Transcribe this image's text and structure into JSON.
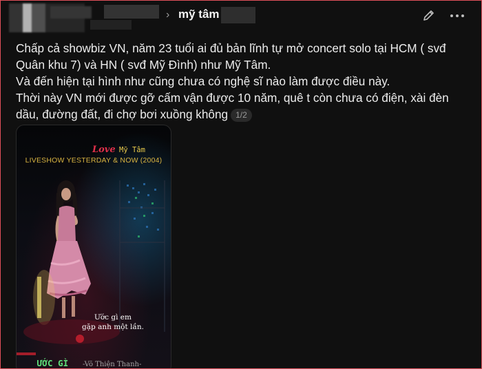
{
  "header": {
    "username": "mỹ tâm",
    "chevron": "›",
    "edit_icon": "pencil-icon",
    "more_icon": "more-horizontal-icon"
  },
  "post": {
    "lines": [
      "Chấp cả showbiz VN, năm 23 tuổi ai đủ bản lĩnh tự mở concert solo tại HCM ( svđ Quân khu 7) và HN ( svđ Mỹ Đình) như Mỹ Tâm.",
      "Và đến hiện tại hình như cũng chưa có nghệ sĩ nào làm được điều này.",
      "Thời này VN mới được gỡ cấm vận được 10 năm, quê t còn chưa có điện, xài đèn dầu, đường đất, đi chợ bơi xuồng không"
    ],
    "page_indicator": "1/2"
  },
  "media": {
    "love_word": "Love",
    "singer_tag": "Mỹ Tâm",
    "show_title": "LIVESHOW YESTERDAY & NOW (2004)",
    "lyric_line1": "Ước gì em",
    "lyric_line2": "gặp anh một lần.",
    "song_title": "ƯỚC GÌ",
    "composer": "-Võ Thiện Thanh-"
  },
  "colors": {
    "background": "#101010",
    "border": "#e0505a",
    "text": "#ececec",
    "title_gold": "#d9b441",
    "song_green": "#5ee07a"
  }
}
